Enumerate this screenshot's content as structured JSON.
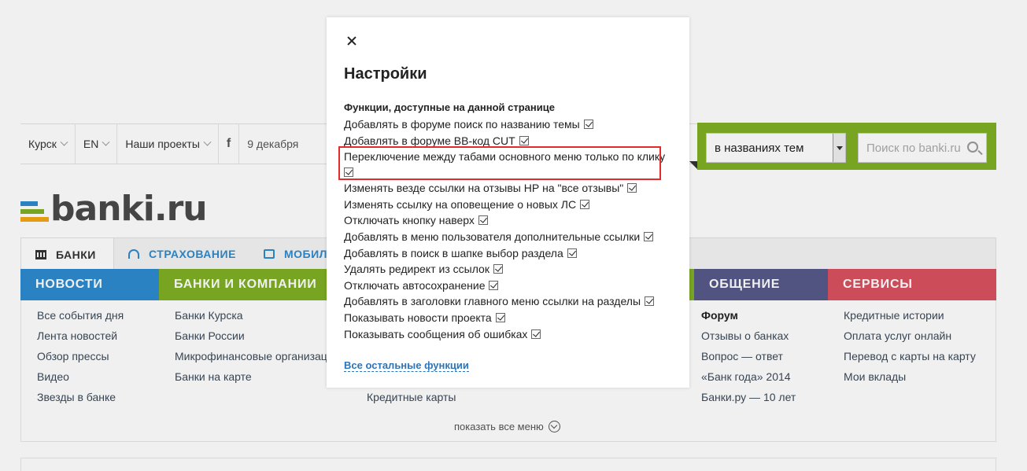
{
  "topbar": {
    "items": [
      "Курск",
      "EN",
      "Наши проекты"
    ],
    "facebook": "f",
    "date": "9 декабря"
  },
  "search": {
    "scope": "в названиях тем",
    "placeholder": "Поиск по banki.ru"
  },
  "logo": {
    "text": "banki",
    "suffix": ".ru"
  },
  "tabs": [
    {
      "label": "БАНКИ",
      "icon": "bank-icon"
    },
    {
      "label": "СТРАХОВАНИЕ",
      "icon": "umbrella-icon"
    },
    {
      "label": "МОБИЛ",
      "icon": "mobile-icon"
    }
  ],
  "menu": {
    "headers": [
      "НОВОСТИ",
      "БАНКИ И КОМПАНИИ",
      "ОБЩЕНИЕ",
      "СЕРВИСЫ"
    ],
    "news": [
      "Все события дня",
      "Лента новостей",
      "Обзор прессы",
      "Видео",
      "Звезды в банке"
    ],
    "banks": [
      "Банки Курска",
      "Банки России",
      "Микрофинансовые организации",
      "Банки на карте"
    ],
    "middle": [
      "Кредитные карты"
    ],
    "community": [
      "Форум",
      "Отзывы о банках",
      "Вопрос — ответ",
      "«Банк года» 2014",
      "Банки.ру — 10 лет"
    ],
    "services": [
      "Кредитные истории",
      "Оплата услуг онлайн",
      "Перевод с карты на карту",
      "Мои вклады"
    ],
    "show_all": "показать все меню"
  },
  "modal": {
    "title": "Настройки",
    "subtitle": "Функции, доступные на данной странице",
    "options": [
      "Добавлять в форуме поиск по названию темы",
      "Добавлять в форуме BB-код CUT",
      "Переключение между табами основного меню только по клику",
      "Изменять везде ссылки на отзывы НР на \"все отзывы\"",
      "Изменять ссылку на оповещение о новых ЛС",
      "Отключать кнопку наверх",
      "Добавлять в меню пользователя дополнительные ссылки",
      "Добавлять в поиск в шапке выбор раздела",
      "Удалять редирект из ссылок",
      "Отключать автосохранение",
      "Добавлять в заголовки главного меню ссылки на разделы",
      "Показывать новости проекта",
      "Показывать сообщения об ошибках"
    ],
    "more_link": "Все остальные функции"
  },
  "colors": {
    "news": "#2d8bcf",
    "banks": "#7fb024",
    "community": "#575a8a",
    "services": "#d9515f",
    "highlight": "#e32b2b",
    "link": "#2d75b8"
  }
}
